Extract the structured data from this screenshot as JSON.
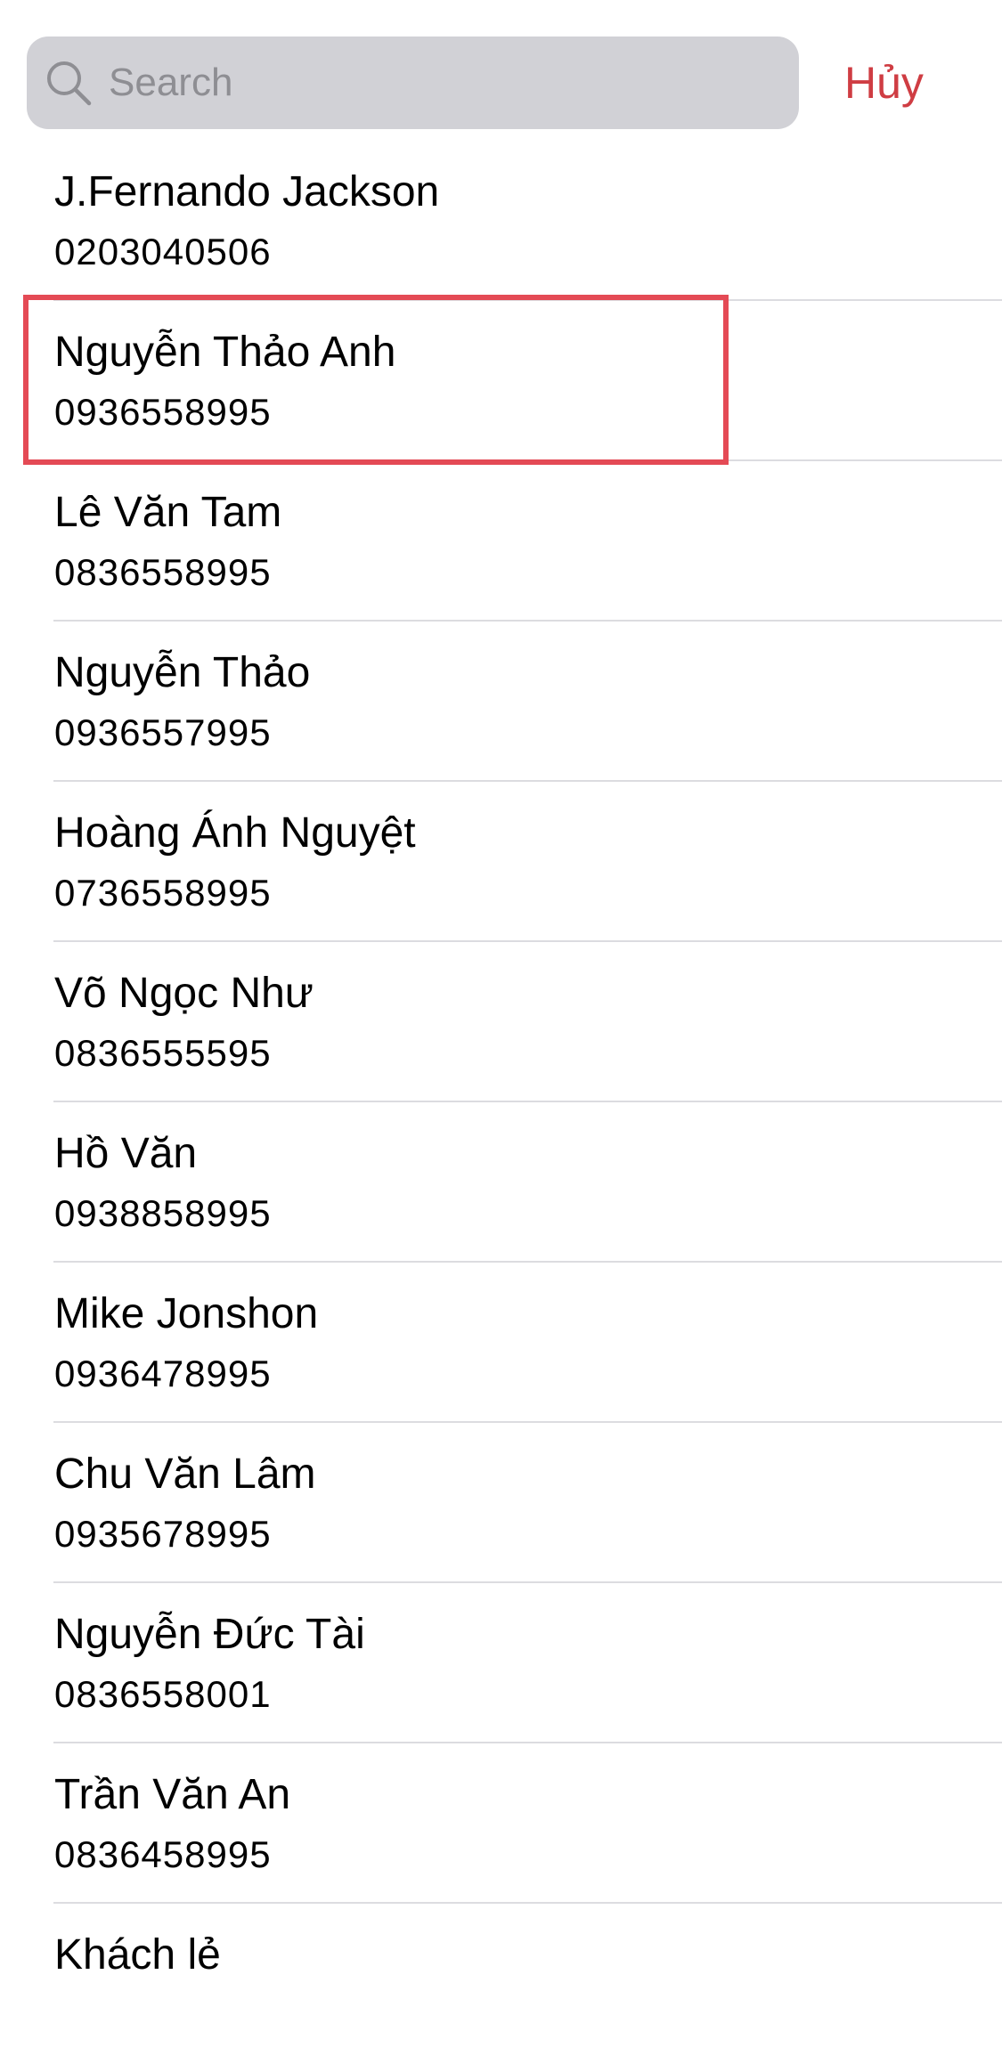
{
  "search": {
    "placeholder": "Search",
    "value": "",
    "icon": "search-icon"
  },
  "cancel_label": "Hủy",
  "colors": {
    "accent": "#cf3d43",
    "highlight": "#e44a55",
    "search_bg": "#d1d1d6",
    "placeholder": "#8e8e93"
  },
  "contacts": [
    {
      "name": "J.Fernando Jackson",
      "phone": "0203040506"
    },
    {
      "name": "Nguyễn Thảo Anh",
      "phone": "0936558995",
      "highlighted": true
    },
    {
      "name": "Lê Văn Tam",
      "phone": "0836558995"
    },
    {
      "name": "Nguyễn Thảo",
      "phone": "0936557995"
    },
    {
      "name": "Hoàng Ánh Nguyệt",
      "phone": "0736558995"
    },
    {
      "name": "Võ Ngọc Như",
      "phone": "0836555595"
    },
    {
      "name": "Hồ Văn",
      "phone": "0938858995"
    },
    {
      "name": "Mike Jonshon",
      "phone": "0936478995"
    },
    {
      "name": "Chu Văn Lâm",
      "phone": "0935678995"
    },
    {
      "name": "Nguyễn Đức Tài",
      "phone": "0836558001"
    },
    {
      "name": "Trần Văn An",
      "phone": "0836458995"
    },
    {
      "name": "Khách lẻ",
      "phone": ""
    }
  ]
}
